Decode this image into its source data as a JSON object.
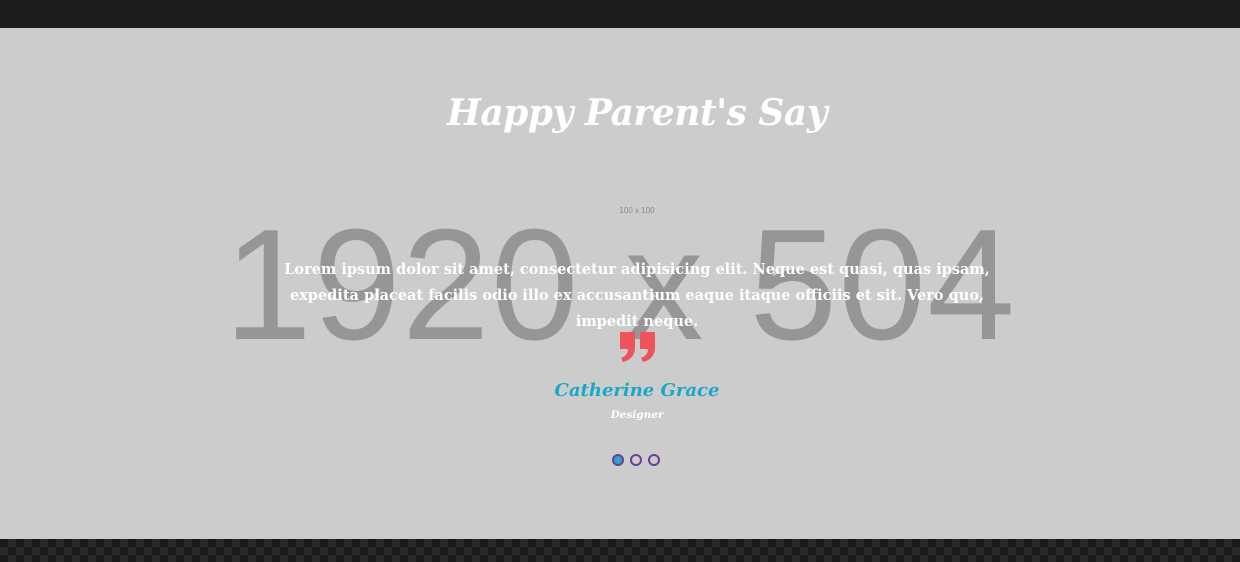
{
  "testimonials": {
    "title": "Happy Parent's Say",
    "background_placeholder": "1920 x 504",
    "avatar_placeholder": "100 x 100",
    "quote": "Lorem ipsum dolor sit amet, consectetur adipisicing elit. Neque est quasi, quas ipsam, expedita placeat facilis odio illo ex accusantium eaque itaque officiis et sit. Vero quo, impedit neque.",
    "author_name": "Catherine Grace",
    "author_role": "Designer",
    "slides": [
      {
        "active": true
      },
      {
        "active": false
      },
      {
        "active": false
      }
    ]
  },
  "colors": {
    "section_bg": "#cccccc",
    "name": "#1aa8c9",
    "quote_icon": "#f0525c",
    "dot_border": "#6a3f93",
    "dot_active": "#2fa0d4"
  },
  "icons": {
    "quote": "quote-close-icon"
  }
}
